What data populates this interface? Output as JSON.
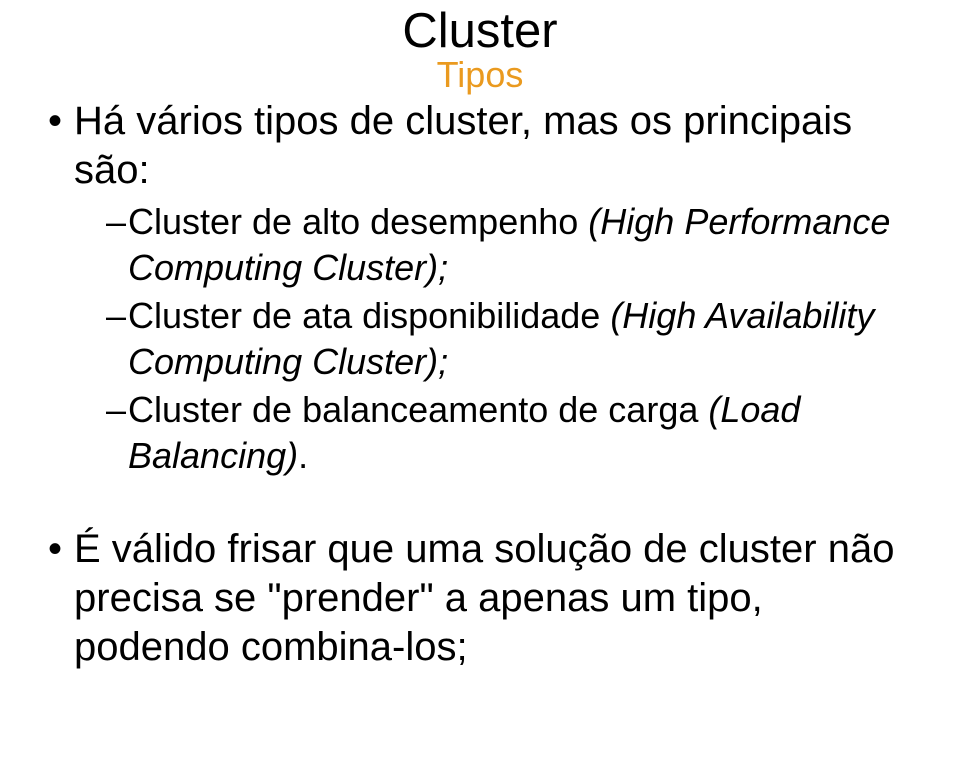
{
  "title": "Cluster",
  "subtitle": "Tipos",
  "bullet1": {
    "intro": "Há vários tipos de cluster, mas os principais são:",
    "items": [
      {
        "prefix": "Cluster de alto desempenho ",
        "italic": "(High Performance Computing Cluster);"
      },
      {
        "prefix": "Cluster de ata disponibilidade ",
        "italic": "(High Availability Computing Cluster);"
      },
      {
        "prefix": "Cluster de balanceamento de carga ",
        "italic": "(Load Balancing)",
        "suffix": "."
      }
    ]
  },
  "bullet2": "É válido frisar que uma solução de cluster não precisa se \"prender\" a apenas um tipo, podendo combina-los;"
}
